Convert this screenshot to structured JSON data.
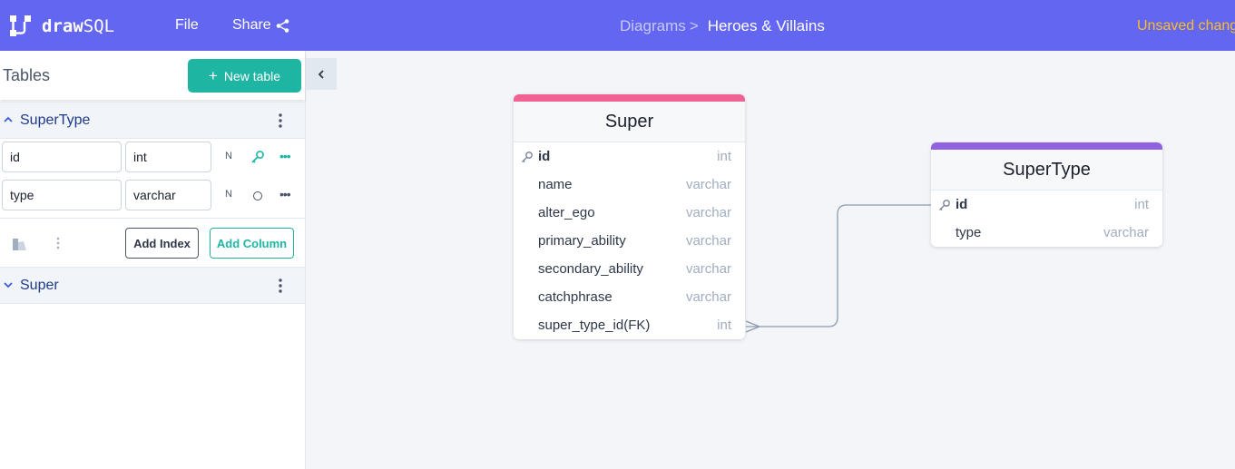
{
  "app": {
    "logo_prefix": "draw",
    "logo_suffix": "SQL",
    "menu": {
      "file": "File",
      "share": "Share"
    },
    "breadcrumb": {
      "root": "Diagrams",
      "separator": ">",
      "current": "Heroes & Villains"
    },
    "status": "Unsaved changes",
    "colors": {
      "brand": "#6366f1",
      "accent": "#1fb5a3",
      "warning": "#fbbf24"
    }
  },
  "sidebar": {
    "title": "Tables",
    "new_table_label": "New table",
    "tables": [
      {
        "name": "SuperType",
        "expanded": true,
        "columns": [
          {
            "name": "id",
            "type": "int",
            "nullable_flag": "N",
            "primary_key": true
          },
          {
            "name": "type",
            "type": "varchar",
            "nullable_flag": "N",
            "primary_key": false
          }
        ],
        "add_index_label": "Add Index",
        "add_column_label": "Add Column"
      },
      {
        "name": "Super",
        "expanded": false
      }
    ]
  },
  "diagram": {
    "tables": [
      {
        "name": "Super",
        "color": "#f06292",
        "columns": [
          {
            "name": "id",
            "type": "int",
            "primary_key": true
          },
          {
            "name": "name",
            "type": "varchar"
          },
          {
            "name": "alter_ego",
            "type": "varchar"
          },
          {
            "name": "primary_ability",
            "type": "varchar"
          },
          {
            "name": "secondary_ability",
            "type": "varchar"
          },
          {
            "name": "catchphrase",
            "type": "varchar"
          },
          {
            "name": "super_type_id(FK)",
            "type": "int"
          }
        ]
      },
      {
        "name": "SuperType",
        "color": "#9061e0",
        "columns": [
          {
            "name": "id",
            "type": "int",
            "primary_key": true
          },
          {
            "name": "type",
            "type": "varchar"
          }
        ]
      }
    ],
    "relations": [
      {
        "from": "Super.super_type_id(FK)",
        "to": "SuperType.id",
        "cardinality": "many-to-one"
      }
    ]
  }
}
